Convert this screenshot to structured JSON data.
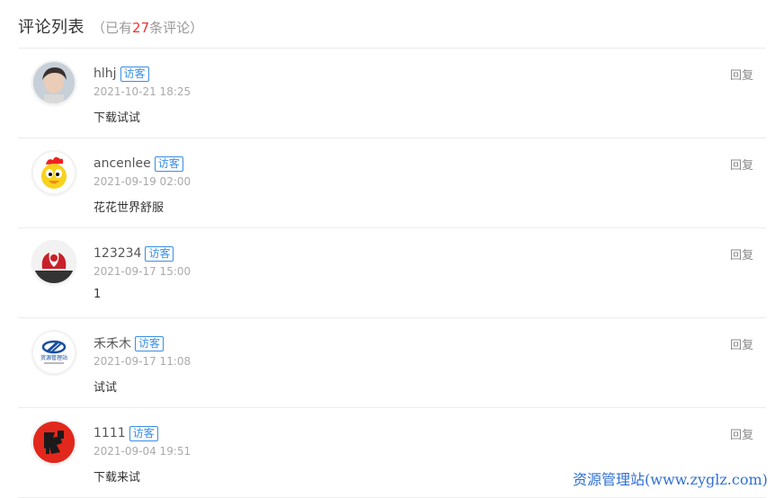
{
  "header": {
    "title": "评论列表",
    "paren_open": "（",
    "prefix": "已有",
    "count": "27",
    "suffix": "条评论",
    "paren_close": "）"
  },
  "comments": [
    {
      "name": "hlhj",
      "badge": "访客",
      "date": "2021-10-21 18:25",
      "content": "下载试试",
      "reply": "回复",
      "avatar": "person-photo"
    },
    {
      "name": "ancenlee",
      "badge": "访客",
      "date": "2021-09-19 02:00",
      "content": "花花世界舒服",
      "reply": "回复",
      "avatar": "cartoon-chick"
    },
    {
      "name": "123234",
      "badge": "访客",
      "date": "2021-09-17 15:00",
      "content": "1",
      "reply": "回复",
      "avatar": "red-emblem"
    },
    {
      "name": "禾禾木",
      "badge": "访客",
      "date": "2021-09-17 11:08",
      "content": "试试",
      "reply": "回复",
      "avatar": "logo-zyglz",
      "avatar_text": "资源管理站"
    },
    {
      "name": "1111",
      "badge": "访客",
      "date": "2021-09-04 19:51",
      "content": "下载来试",
      "reply": "回复",
      "avatar": "red-calligraphy"
    }
  ],
  "watermark": "资源管理站(www.zyglz.com)",
  "colors": {
    "accent": "#3a8ee6",
    "count": "#ee3333",
    "watermark": "#2f6fd3"
  }
}
